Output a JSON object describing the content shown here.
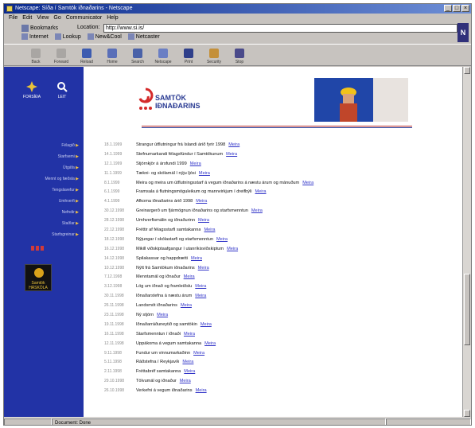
{
  "window": {
    "title": "Netscape: Síða í Samtök iðnaðarins - Netscape"
  },
  "menubar": [
    "File",
    "Edit",
    "View",
    "Go",
    "Communicator",
    "Help"
  ],
  "nav": {
    "bookmarks_label": "Bookmarks",
    "location_label": "Location:",
    "location_value": "http://www.si.is/",
    "personal": [
      "Internet",
      "Lookup",
      "New&Cool",
      "Netcaster"
    ]
  },
  "toolbar": [
    "Back",
    "Forward",
    "Reload",
    "Home",
    "Search",
    "Netscape",
    "Print",
    "Security",
    "Stop"
  ],
  "sidebar": {
    "top_icons": [
      "FORSÍÐA",
      "LEIT"
    ],
    "nav": [
      "Félagið",
      "Starfsemi",
      "Útgáfa",
      "Mennt og fæðsla",
      "Tengslavefur",
      "Umhverfi",
      "Nefndir",
      "Staðlar",
      "Starfsgreinar"
    ],
    "badge": "Samtök HÁSKÓLA"
  },
  "brand": {
    "line1": "SAMTÖK",
    "line2": "IÐNAÐARINS"
  },
  "news": [
    {
      "date": "18.1.1999",
      "text": "Strangur útflutningur frá Íslandi árið fyrir 1998",
      "more": "Meira"
    },
    {
      "date": "14.1.1999",
      "text": "Stefnumarkandi félagsfúndur í Samtökunum",
      "more": "Meira"
    },
    {
      "date": "12.1.1999",
      "text": "Stjórnkjör á ársfundi 1999",
      "more": "Meira"
    },
    {
      "date": "11.1.1999",
      "text": "Tækni- og skólamál í nýju ljósi",
      "more": "Meira"
    },
    {
      "date": "8.1.1999",
      "text": "Meira og meira um útflutningsstarf á vegum iðnaðarins á næstu árum og mánuðum",
      "more": "Meira"
    },
    {
      "date": "6.1.1999",
      "text": "Framsala á flutningsmöguleikum og mannvirkjum í dreifbýli",
      "more": "Meira"
    },
    {
      "date": "4.1.1999",
      "text": "Afkoma iðnaðarins árið 1998",
      "more": "Meira"
    },
    {
      "date": "30.12.1998",
      "text": "Greinargerð um fjármögnun iðnaðarins og starfsmenntun",
      "more": "Meira"
    },
    {
      "date": "28.12.1998",
      "text": "Umhverfismálin og iðnaðurinn",
      "more": "Meira"
    },
    {
      "date": "22.12.1998",
      "text": "Fréttir af félagsstarfi samtakanna",
      "more": "Meira"
    },
    {
      "date": "18.12.1998",
      "text": "Nýjungar í skólastarfi og starfsmenntun",
      "more": "Meira"
    },
    {
      "date": "16.12.1998",
      "text": "Mikill viðskiptaafgangur í utanríkisviðskiptum",
      "more": "Meira"
    },
    {
      "date": "14.12.1998",
      "text": "Spilakassar og happdrætti",
      "more": "Meira"
    },
    {
      "date": "10.12.1998",
      "text": "Nýtt frá Samtökum iðnaðarins",
      "more": "Meira"
    },
    {
      "date": "7.12.1998",
      "text": "Menntamál og iðnaður",
      "more": "Meira"
    },
    {
      "date": "3.12.1998",
      "text": "Lög um iðnað og framleiðslu",
      "more": "Meira"
    },
    {
      "date": "30.11.1998",
      "text": "Iðnaðarstefna á næstu árum",
      "more": "Meira"
    },
    {
      "date": "26.11.1998",
      "text": "Landsmót iðnaðarins",
      "more": "Meira"
    },
    {
      "date": "23.11.1998",
      "text": "Ný stjórn",
      "more": "Meira"
    },
    {
      "date": "19.11.1998",
      "text": "Iðnaðarráðuneytið og samtökin",
      "more": "Meira"
    },
    {
      "date": "16.11.1998",
      "text": "Starfsmenntun í iðnaði",
      "more": "Meira"
    },
    {
      "date": "12.11.1998",
      "text": "Uppákoma á vegum samtakanna",
      "more": "Meira"
    },
    {
      "date": "9.11.1998",
      "text": "Fundur um vinnumarkaðinn",
      "more": "Meira"
    },
    {
      "date": "5.11.1998",
      "text": "Ráðstefna í Reykjavík",
      "more": "Meira"
    },
    {
      "date": "2.11.1998",
      "text": "Fréttabréf samtakanna",
      "more": "Meira"
    },
    {
      "date": "29.10.1998",
      "text": "Tölvumál og iðnaður",
      "more": "Meira"
    },
    {
      "date": "26.10.1998",
      "text": "Verkefni á vegum iðnaðarins",
      "more": "Meira"
    }
  ],
  "status": {
    "text": "Document: Done"
  }
}
